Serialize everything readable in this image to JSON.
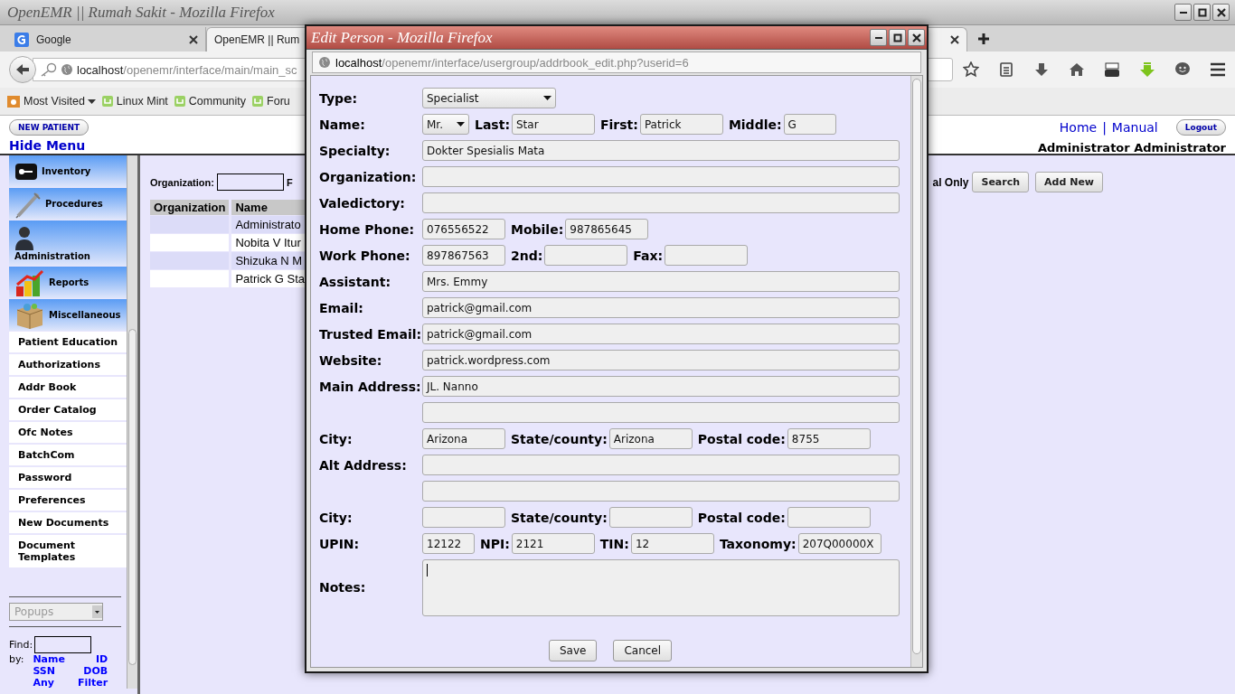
{
  "window": {
    "title": "OpenEMR || Rumah Sakit - Mozilla Firefox"
  },
  "tabs": [
    {
      "label": "Google",
      "selected": false
    },
    {
      "label": "OpenEMR || Rum",
      "selected": true
    }
  ],
  "address_bar": {
    "host": "localhost",
    "path": "/openemr/interface/main/main_sc"
  },
  "bookmarks": [
    {
      "label": "Most Visited",
      "kind": "folder"
    },
    {
      "label": "Linux Mint",
      "kind": "mint"
    },
    {
      "label": "Community",
      "kind": "mint"
    },
    {
      "label": "Foru",
      "kind": "mint"
    }
  ],
  "header": {
    "new_patient": "NEW PATIENT",
    "hide_menu": "Hide Menu",
    "links": [
      "Home",
      "Manual"
    ],
    "separator": "|",
    "logout": "Logout",
    "user": "Administrator Administrator"
  },
  "sidebar": {
    "items": [
      {
        "label": "Inventory",
        "kind": "category"
      },
      {
        "label": "Procedures",
        "kind": "category"
      },
      {
        "label": "Administration",
        "kind": "tallcategory"
      },
      {
        "label": "Reports",
        "kind": "category"
      },
      {
        "label": "Miscellaneous",
        "kind": "category"
      },
      {
        "label": "Patient Education",
        "kind": "link"
      },
      {
        "label": "Authorizations",
        "kind": "link"
      },
      {
        "label": "Addr Book",
        "kind": "link"
      },
      {
        "label": "Order Catalog",
        "kind": "link"
      },
      {
        "label": "Ofc Notes",
        "kind": "link"
      },
      {
        "label": "BatchCom",
        "kind": "link"
      },
      {
        "label": "Password",
        "kind": "link"
      },
      {
        "label": "Preferences",
        "kind": "link"
      },
      {
        "label": "New Documents",
        "kind": "link"
      },
      {
        "label": "Document Templates",
        "kind": "link"
      }
    ],
    "popups": {
      "value": "Popups",
      "disabled": true
    },
    "find": {
      "label": "Find:",
      "by_label": "by:",
      "links": [
        "Name",
        "ID",
        "SSN",
        "DOB",
        "Any",
        "Filter"
      ]
    }
  },
  "filter": {
    "organization_label": "Organization:",
    "cut_label": "F",
    "trailing_label": "al Only",
    "buttons": [
      "Search",
      "Add New"
    ]
  },
  "table": {
    "columns": [
      "Organization",
      "Name"
    ],
    "rows": [
      {
        "name": "Administrato"
      },
      {
        "name": "Nobita V Itur"
      },
      {
        "name": "Shizuka N M"
      },
      {
        "name": "Patrick G Sta"
      }
    ]
  },
  "dialog": {
    "title": "Edit Person - Mozilla Firefox",
    "url_host": "localhost",
    "url_path": "/openemr/interface/usergroup/addrbook_edit.php?userid=6",
    "rows": [
      {
        "items": [
          {
            "label": "Type:",
            "kind": "select",
            "value": "Specialist"
          }
        ]
      },
      {
        "items": [
          {
            "label": "Name:",
            "kind": "shortselect",
            "value": "Mr."
          },
          {
            "label": "Last:",
            "kind": "text",
            "value": "Star"
          },
          {
            "label": "First:",
            "kind": "text",
            "value": "Patrick"
          },
          {
            "label": "Middle:",
            "kind": "short",
            "value": "G"
          }
        ]
      },
      {
        "items": [
          {
            "label": "Specialty:",
            "kind": "wide",
            "value": "Dokter Spesialis Mata"
          }
        ]
      },
      {
        "items": [
          {
            "label": "Organization:",
            "kind": "wide"
          }
        ]
      },
      {
        "items": [
          {
            "label": "Valedictory:",
            "kind": "wide"
          }
        ]
      },
      {
        "items": [
          {
            "label": "Home Phone:",
            "kind": "text",
            "value": "076556522"
          },
          {
            "label": "Mobile:",
            "kind": "text",
            "value": "987865645"
          }
        ]
      },
      {
        "items": [
          {
            "label": "Work Phone:",
            "kind": "text",
            "value": "897867563"
          },
          {
            "label": "2nd:",
            "kind": "text"
          },
          {
            "label": "Fax:",
            "kind": "text"
          }
        ]
      },
      {
        "items": [
          {
            "label": "Assistant:",
            "kind": "wide",
            "value": "Mrs. Emmy"
          }
        ]
      },
      {
        "items": [
          {
            "label": "Email:",
            "kind": "wide",
            "value": "patrick@gmail.com"
          }
        ]
      },
      {
        "items": [
          {
            "label": "Trusted Email:",
            "kind": "wide",
            "value": "patrick@gmail.com"
          }
        ]
      },
      {
        "items": [
          {
            "label": "Website:",
            "kind": "wide",
            "value": "patrick.wordpress.com"
          }
        ]
      },
      {
        "items": [
          {
            "label": "Main Address:",
            "kind": "wide",
            "value": "JL. Nanno"
          }
        ]
      },
      {
        "items": [
          {
            "kind": "wide"
          }
        ]
      },
      {
        "items": [
          {
            "label": "City:",
            "kind": "text",
            "value": "Arizona"
          },
          {
            "label": "State/county:",
            "kind": "text",
            "value": "Arizona"
          },
          {
            "label": "Postal code:",
            "kind": "text",
            "value": "8755"
          }
        ]
      },
      {
        "items": [
          {
            "label": "Alt Address:",
            "kind": "wide"
          }
        ]
      },
      {
        "items": [
          {
            "kind": "wide"
          }
        ]
      },
      {
        "items": [
          {
            "label": "City:",
            "kind": "text"
          },
          {
            "label": "State/county:",
            "kind": "text"
          },
          {
            "label": "Postal code:",
            "kind": "text"
          }
        ]
      },
      {
        "items": [
          {
            "label": "UPIN:",
            "kind": "short",
            "value": "12122"
          },
          {
            "label": "NPI:",
            "kind": "text",
            "value": "2121"
          },
          {
            "label": "TIN:",
            "kind": "text",
            "value": "12"
          },
          {
            "label": "Taxonomy:",
            "kind": "text",
            "value": "207Q00000X"
          }
        ]
      },
      {
        "items": [
          {
            "label": "Notes:",
            "kind": "textarea",
            "focused": true
          }
        ]
      }
    ],
    "buttons": [
      "Save",
      "Cancel"
    ]
  }
}
